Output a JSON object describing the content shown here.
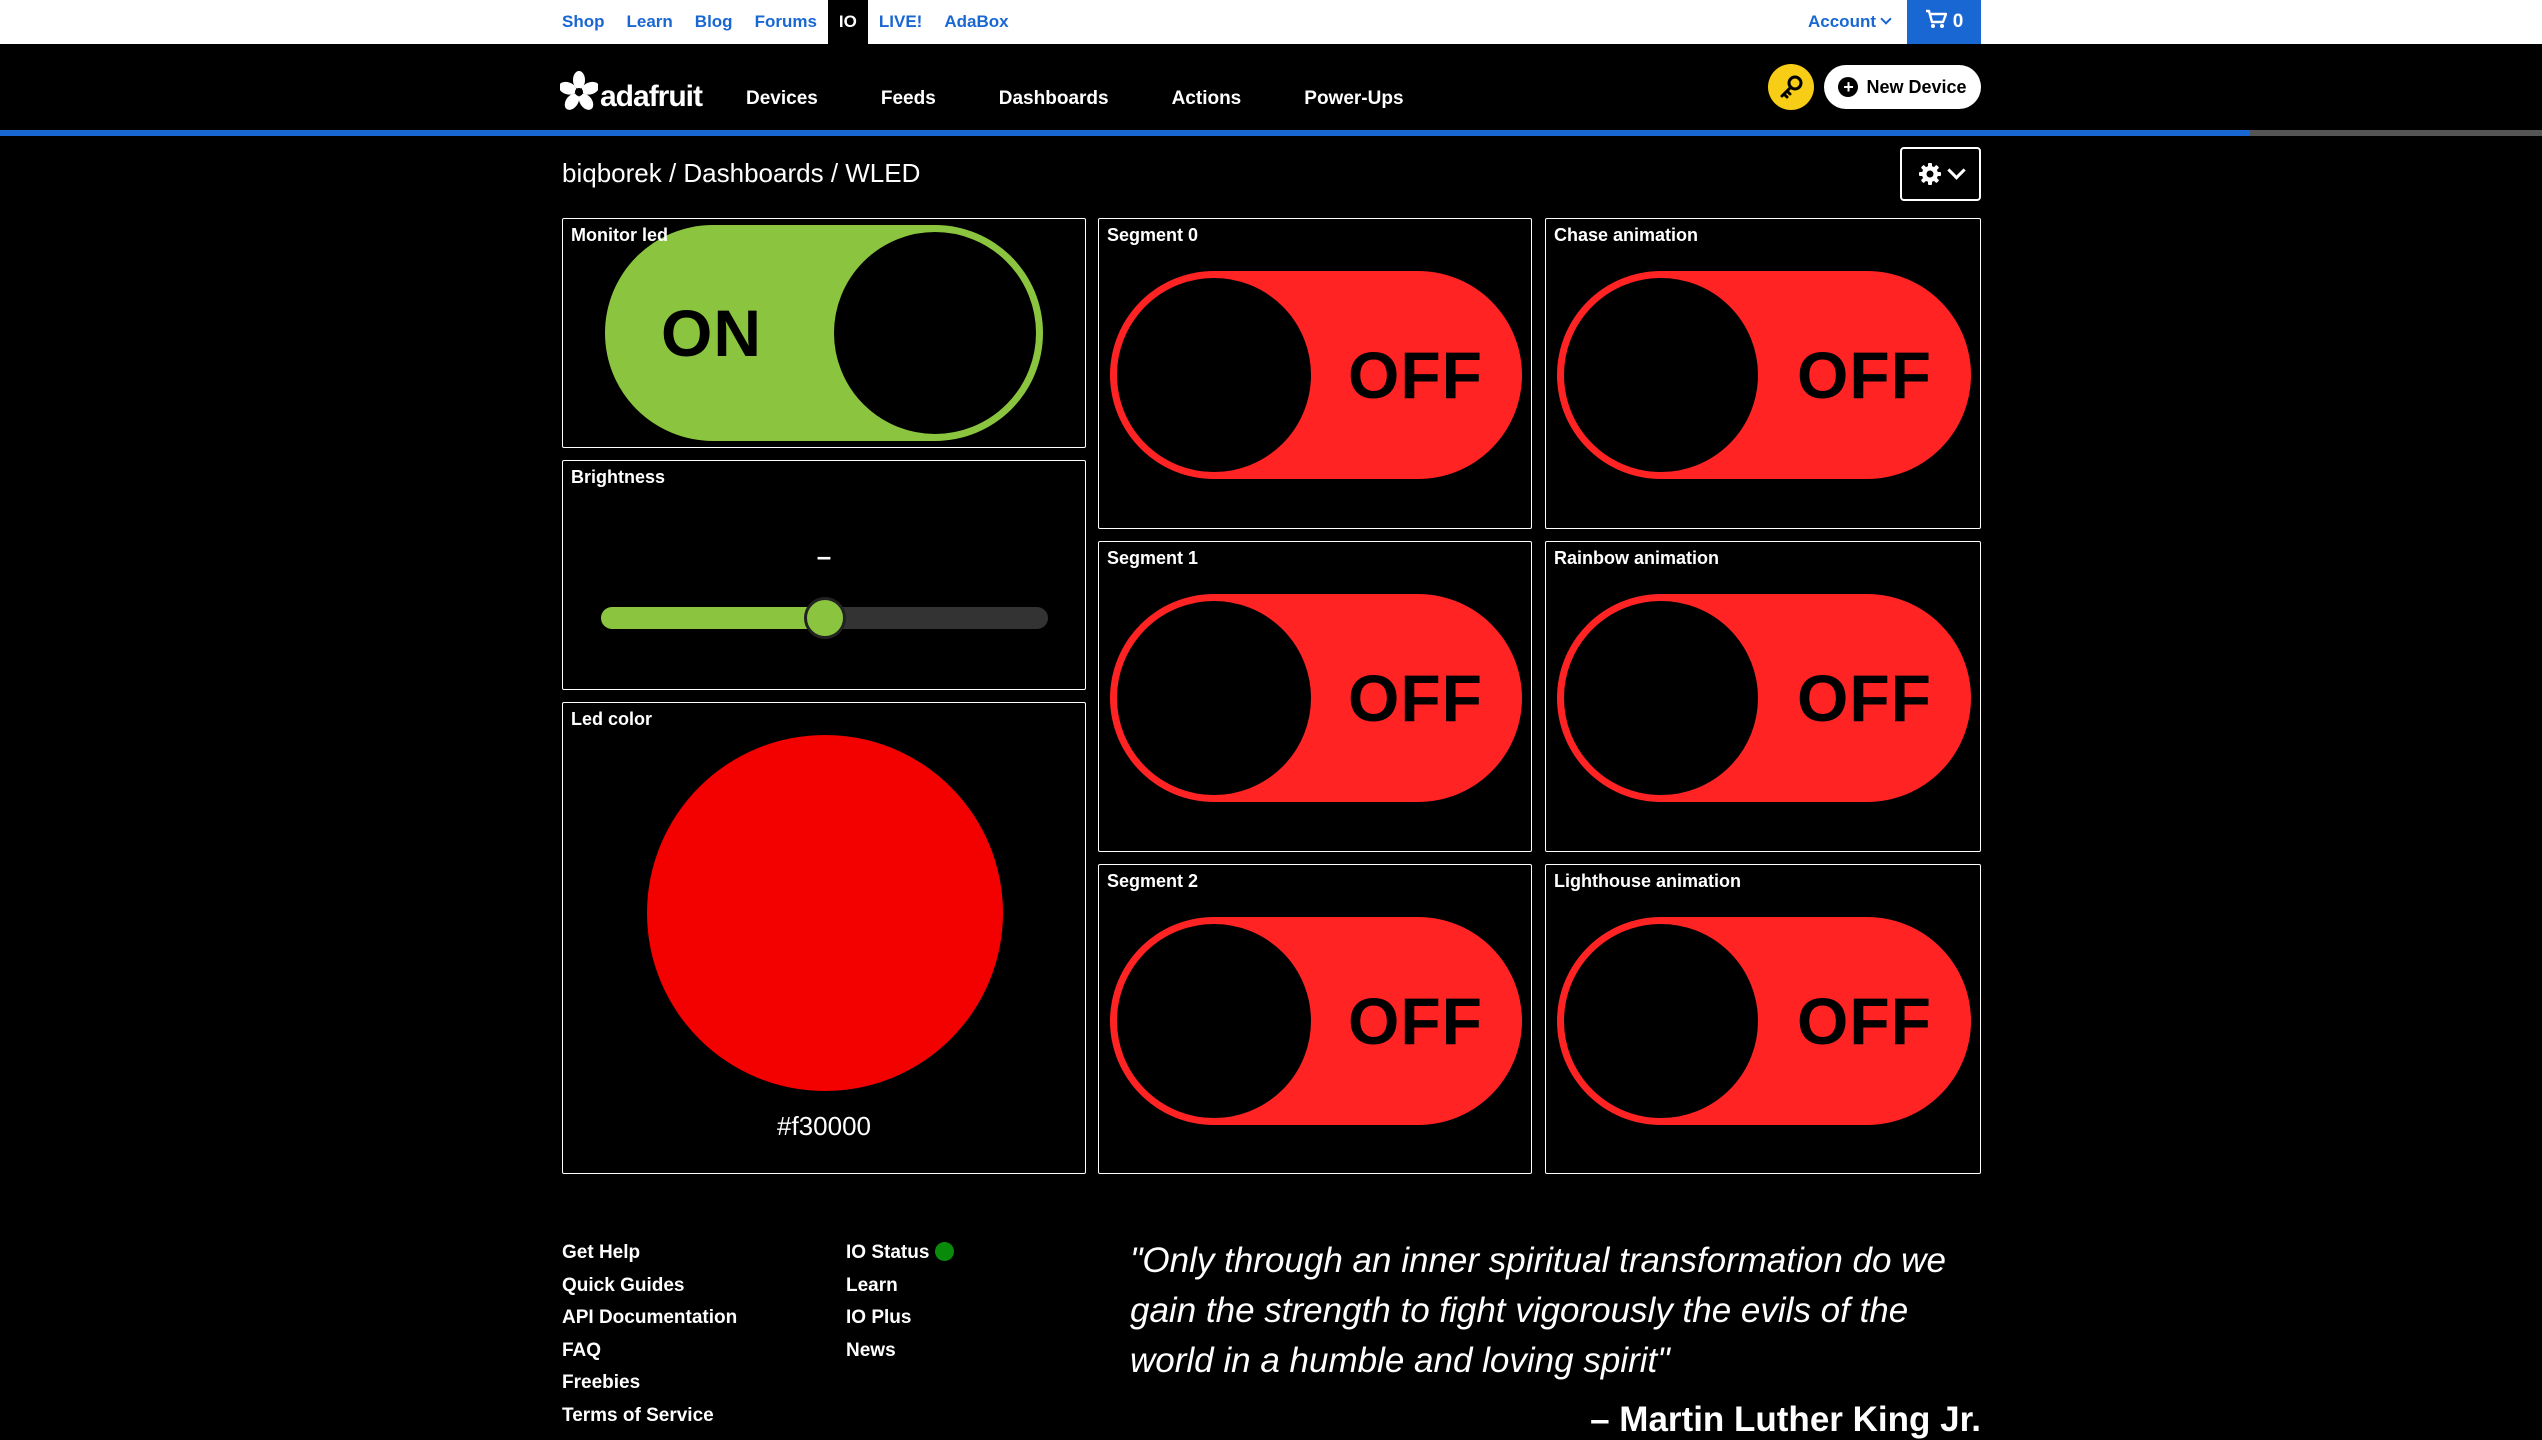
{
  "topbar": {
    "links": [
      "Shop",
      "Learn",
      "Blog",
      "Forums",
      "IO",
      "LIVE!",
      "AdaBox"
    ],
    "active": "IO",
    "account_label": "Account",
    "cart_count": "0"
  },
  "nav": {
    "logo_text": "adafruit",
    "items": [
      "Devices",
      "Feeds",
      "Dashboards",
      "Actions",
      "Power-Ups"
    ],
    "new_device_label": "New Device"
  },
  "breadcrumb": "biqborek / Dashboards / WLED",
  "blocks": {
    "monitor": {
      "title": "Monitor led",
      "state": "ON"
    },
    "brightness": {
      "title": "Brightness",
      "value_text": "–",
      "level": 0.5
    },
    "ledcolor": {
      "title": "Led color",
      "hex": "#f30000",
      "color": "#f30000"
    },
    "seg0": {
      "title": "Segment 0",
      "state": "OFF"
    },
    "seg1": {
      "title": "Segment 1",
      "state": "OFF"
    },
    "seg2": {
      "title": "Segment 2",
      "state": "OFF"
    },
    "chase": {
      "title": "Chase animation",
      "state": "OFF"
    },
    "rainbow": {
      "title": "Rainbow animation",
      "state": "OFF"
    },
    "lighthouse": {
      "title": "Lighthouse animation",
      "state": "OFF"
    }
  },
  "colors": {
    "on": "#8bc53f",
    "off": "#ff2323",
    "accent": "#1967d2",
    "key": "#f7cd15",
    "status": "#0a8a0a"
  },
  "footer": {
    "col1": [
      "Get Help",
      "Quick Guides",
      "API Documentation",
      "FAQ",
      "Freebies",
      "Terms of Service"
    ],
    "col2": [
      "IO Status",
      "Learn",
      "IO Plus",
      "News"
    ],
    "quote": "\"Only through an inner spiritual transformation do we gain the strength to fight vigorously the evils of the world in a humble and loving spirit\"",
    "author": "– Martin Luther King Jr."
  }
}
